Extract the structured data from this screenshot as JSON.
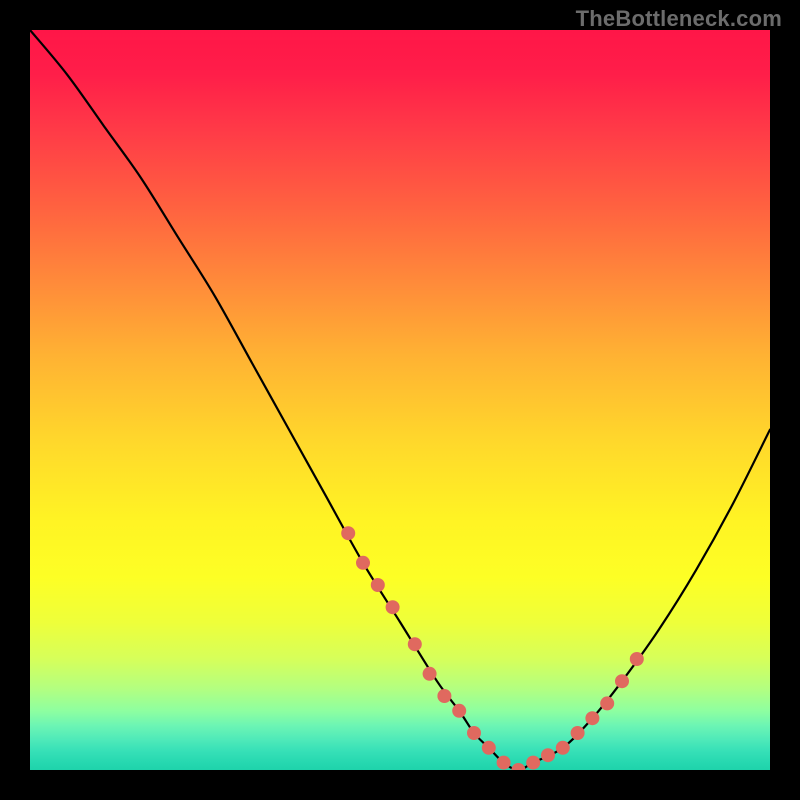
{
  "watermark": "TheBottleneck.com",
  "colors": {
    "background": "#000000",
    "curve": "#000000",
    "dot": "#e0695f",
    "gradient_top": "#ff1648",
    "gradient_bottom": "#1fd3ab"
  },
  "chart_data": {
    "type": "line",
    "title": "",
    "xlabel": "",
    "ylabel": "",
    "xlim": [
      0,
      100
    ],
    "ylim": [
      0,
      100
    ],
    "series": [
      {
        "name": "bottleneck-curve",
        "x": [
          0,
          5,
          10,
          15,
          20,
          25,
          30,
          35,
          40,
          45,
          50,
          55,
          58,
          60,
          62,
          64,
          66,
          68,
          72,
          76,
          80,
          85,
          90,
          95,
          100
        ],
        "y": [
          100,
          94,
          87,
          80,
          72,
          64,
          55,
          46,
          37,
          28,
          20,
          12,
          8,
          5,
          3,
          1,
          0,
          1,
          3,
          7,
          12,
          19,
          27,
          36,
          46
        ]
      }
    ],
    "dots": {
      "name": "highlight-dots",
      "x": [
        43,
        45,
        47,
        49,
        52,
        54,
        56,
        58,
        60,
        62,
        64,
        66,
        68,
        70,
        72,
        74,
        76,
        78,
        80,
        82
      ],
      "y": [
        32,
        28,
        25,
        22,
        17,
        13,
        10,
        8,
        5,
        3,
        1,
        0,
        1,
        2,
        3,
        5,
        7,
        9,
        12,
        15
      ]
    }
  }
}
